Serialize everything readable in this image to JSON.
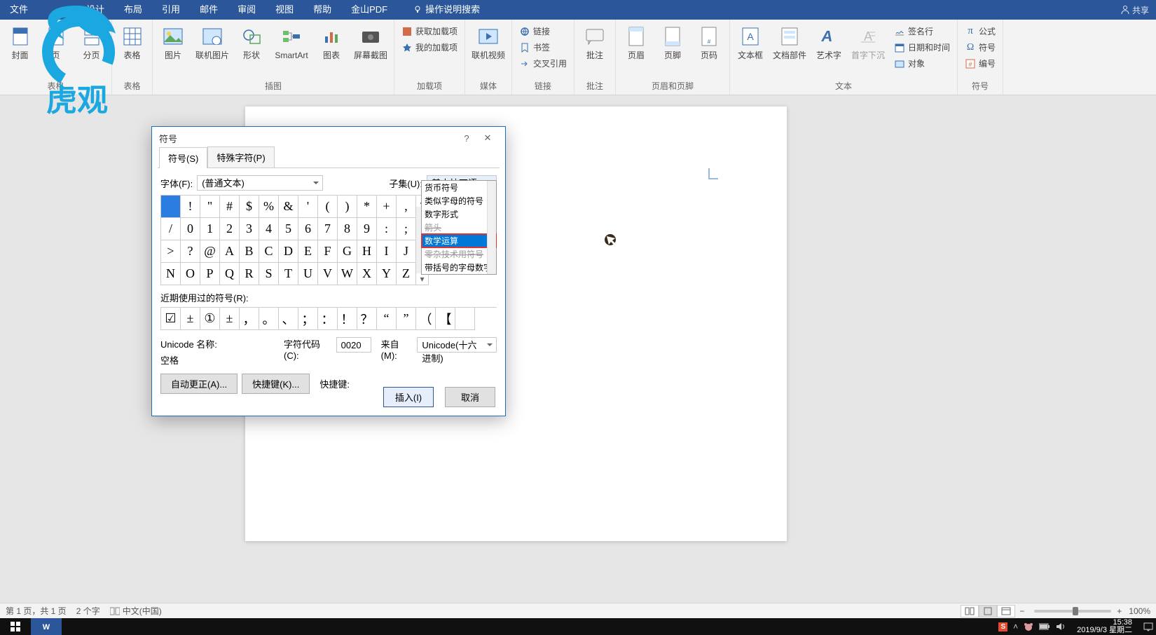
{
  "menu": {
    "file": "文件",
    "design": "设计",
    "layout": "布局",
    "reference": "引用",
    "mail": "邮件",
    "review": "审阅",
    "view": "视图",
    "help": "帮助",
    "pdf": "金山PDF",
    "tellme": "操作说明搜索",
    "share": "共享"
  },
  "ribbon": {
    "groups": {
      "pages": "表格",
      "tables": "表格",
      "illustrations": "插图",
      "addins": "加载项",
      "media": "媒体",
      "links": "链接",
      "comments": "批注",
      "headerfooter": "页眉和页脚",
      "text": "文本",
      "symbols": "符号"
    },
    "cover": "封面",
    "blank": "页",
    "break": "分页",
    "table": "表格",
    "picture": "图片",
    "online_pic": "联机图片",
    "shapes": "形状",
    "smartart": "SmartArt",
    "chart": "图表",
    "screenshot": "屏幕截图",
    "get_addins": "获取加载项",
    "my_addins": "我的加载项",
    "online_video": "联机视频",
    "hyperlink": "链接",
    "bookmark": "书签",
    "crossref": "交叉引用",
    "comment": "批注",
    "header": "页眉",
    "footer": "页脚",
    "pagenum": "页码",
    "textbox": "文本框",
    "quickparts": "文档部件",
    "wordart": "艺术字",
    "dropcap": "首字下沉",
    "sigline": "签名行",
    "datetime": "日期和时间",
    "object": "对象",
    "equation": "公式",
    "symbol": "符号",
    "number": "编号"
  },
  "dialog": {
    "title": "符号",
    "tab_symbols": "符号(S)",
    "tab_special": "特殊字符(P)",
    "font_label": "字体(F):",
    "font_value": "(普通文本)",
    "subset_label": "子集(U):",
    "subset_value": "基本拉丁语",
    "subset_options": [
      "货币符号",
      "类似字母的符号",
      "数字形式",
      "箭头",
      "数学运算",
      "零杂技术用符号",
      "带括号的字母数字"
    ],
    "subset_highlight_index": 4,
    "grid": [
      "",
      "!",
      "\"",
      "#",
      "$",
      "%",
      "&",
      "'",
      "(",
      ")",
      "*",
      "+",
      ",",
      "/",
      "0",
      "1",
      "2",
      "3",
      "4",
      "5",
      "6",
      "7",
      "8",
      "9",
      ":",
      ";",
      ">",
      "?",
      "@",
      "A",
      "B",
      "C",
      "D",
      "E",
      "F",
      "G",
      "H",
      "I",
      "J",
      "N",
      "O",
      "P",
      "Q",
      "R",
      "S",
      "T",
      "U",
      "V",
      "W",
      "X",
      "Y",
      "Z"
    ],
    "recent_label": "近期使用过的符号(R):",
    "recent": [
      "☑",
      "±",
      "①",
      "±",
      "，",
      "。",
      "、",
      "；",
      "：",
      "！",
      "？",
      "“",
      "”",
      "（",
      "【",
      ""
    ],
    "unicode_name_label": "Unicode 名称:",
    "unicode_name_value": "空格",
    "charcode_label": "字符代码(C):",
    "charcode_value": "0020",
    "from_label": "来自(M):",
    "from_value": "Unicode(十六进制)",
    "autocorrect": "自动更正(A)...",
    "shortcutkey": "快捷键(K)...",
    "shortcut_label": "快捷键:",
    "insert": "插入(I)",
    "cancel": "取消"
  },
  "status": {
    "page": "第 1 页，共 1 页",
    "words": "2 个字",
    "lang": "中文(中国)",
    "zoom": "100%"
  },
  "taskbar": {
    "time": "15:38",
    "date": "2019/9/3 星期二"
  },
  "watermark_text": "虎观"
}
